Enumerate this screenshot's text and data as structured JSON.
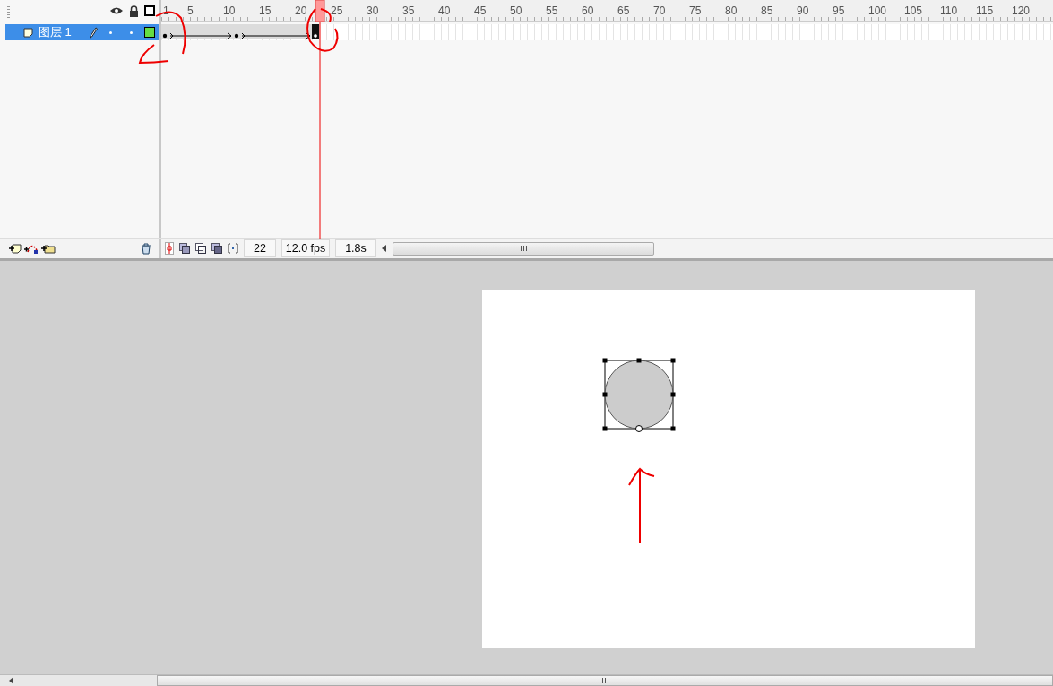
{
  "timeline": {
    "ruler_labels": [
      "1",
      "5",
      "10",
      "15",
      "20",
      "25",
      "30",
      "35",
      "40",
      "45",
      "50",
      "55",
      "60",
      "65",
      "70",
      "75",
      "80",
      "85",
      "90",
      "95",
      "100",
      "105",
      "110",
      "115",
      "120"
    ],
    "layers": [
      {
        "name": "图层 1",
        "selected": true,
        "color": "#66dd44"
      }
    ],
    "status": {
      "current_frame": "22",
      "frame_rate": "12.0 fps",
      "elapsed_time": "1.8s"
    }
  },
  "stage": {
    "shape": {
      "selected": true
    }
  }
}
